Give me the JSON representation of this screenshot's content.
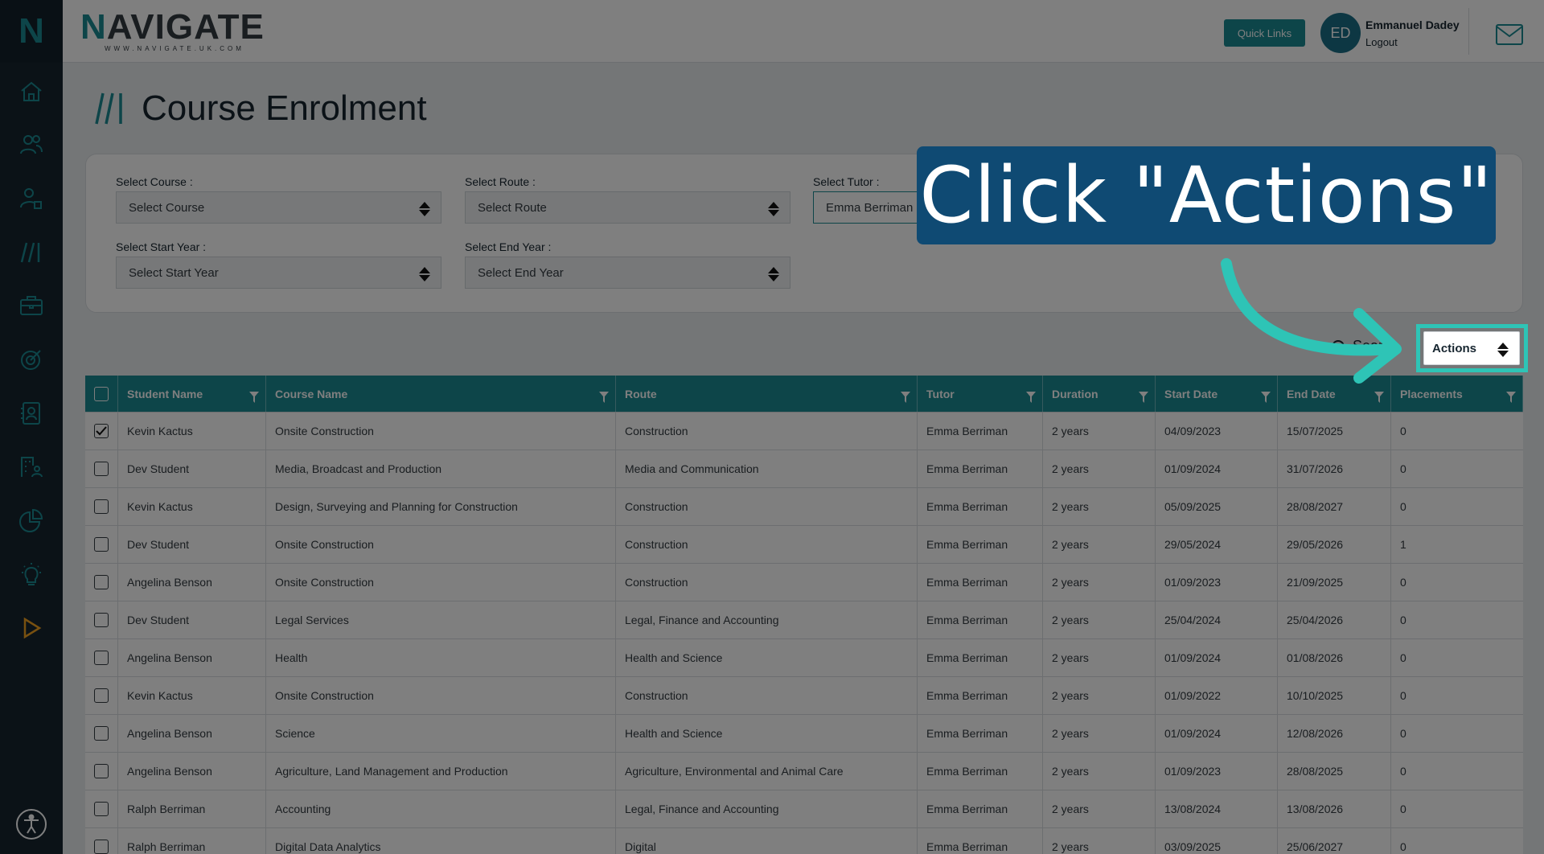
{
  "brand": {
    "name_first": "N",
    "name_rest": "AVIGATE",
    "url": "WWW.NAVIGATE.UK.COM"
  },
  "sidebar": {
    "logo": "N",
    "icons": [
      "home-icon",
      "users-icon",
      "user-tag-icon",
      "courses-icon",
      "briefcase-icon",
      "target-icon",
      "contact-card-icon",
      "building-users-icon",
      "chart-pie-icon",
      "lightbulb-icon",
      "play-icon",
      "accessibility-icon"
    ]
  },
  "header": {
    "quick_links": "Quick Links",
    "avatar_initials": "ED",
    "user_name": "Emmanuel Dadey",
    "logout": "Logout"
  },
  "page": {
    "title": "Course Enrolment"
  },
  "filters": {
    "course_label": "Select Course :",
    "course_value": "Select Course",
    "route_label": "Select Route :",
    "route_value": "Select Route",
    "tutor_label": "Select Tutor :",
    "tutor_value": "Emma Berriman",
    "start_year_label": "Select Start Year :",
    "start_year_value": "Select Start Year",
    "end_year_label": "Select End Year :",
    "end_year_value": "Select End Year"
  },
  "toolbar": {
    "search_label": "Search",
    "actions_label": "Actions"
  },
  "table": {
    "headers": [
      "Student Name",
      "Course Name",
      "Route",
      "Tutor",
      "Duration",
      "Start Date",
      "End Date",
      "Placements"
    ],
    "rows": [
      {
        "checked": true,
        "cells": [
          "Kevin Kactus",
          "Onsite Construction",
          "Construction",
          "Emma Berriman",
          "2 years",
          "04/09/2023",
          "15/07/2025",
          "0"
        ]
      },
      {
        "checked": false,
        "cells": [
          "Dev Student",
          "Media, Broadcast and Production",
          "Media and Communication",
          "Emma Berriman",
          "2 years",
          "01/09/2024",
          "31/07/2026",
          "0"
        ]
      },
      {
        "checked": false,
        "cells": [
          "Kevin Kactus",
          "Design, Surveying and Planning for Construction",
          "Construction",
          "Emma Berriman",
          "2 years",
          "05/09/2025",
          "28/08/2027",
          "0"
        ]
      },
      {
        "checked": false,
        "cells": [
          "Dev Student",
          "Onsite Construction",
          "Construction",
          "Emma Berriman",
          "2 years",
          "29/05/2024",
          "29/05/2026",
          "1"
        ]
      },
      {
        "checked": false,
        "cells": [
          "Angelina Benson",
          "Onsite Construction",
          "Construction",
          "Emma Berriman",
          "2 years",
          "01/09/2023",
          "21/09/2025",
          "0"
        ]
      },
      {
        "checked": false,
        "cells": [
          "Dev Student",
          "Legal Services",
          "Legal, Finance and Accounting",
          "Emma Berriman",
          "2 years",
          "25/04/2024",
          "25/04/2026",
          "0"
        ]
      },
      {
        "checked": false,
        "cells": [
          "Angelina Benson",
          "Health",
          "Health and Science",
          "Emma Berriman",
          "2 years",
          "01/09/2024",
          "01/08/2026",
          "0"
        ]
      },
      {
        "checked": false,
        "cells": [
          "Kevin Kactus",
          "Onsite Construction",
          "Construction",
          "Emma Berriman",
          "2 years",
          "01/09/2022",
          "10/10/2025",
          "0"
        ]
      },
      {
        "checked": false,
        "cells": [
          "Angelina Benson",
          "Science",
          "Health and Science",
          "Emma Berriman",
          "2 years",
          "01/09/2024",
          "12/08/2026",
          "0"
        ]
      },
      {
        "checked": false,
        "cells": [
          "Angelina Benson",
          "Agriculture, Land Management and Production",
          "Agriculture, Environmental and Animal Care",
          "Emma Berriman",
          "2 years",
          "01/09/2023",
          "28/08/2025",
          "0"
        ]
      },
      {
        "checked": false,
        "cells": [
          "Ralph Berriman",
          "Accounting",
          "Legal, Finance and Accounting",
          "Emma Berriman",
          "2 years",
          "13/08/2024",
          "13/08/2026",
          "0"
        ]
      },
      {
        "checked": false,
        "cells": [
          "Ralph Berriman",
          "Digital Data Analytics",
          "Digital",
          "Emma Berriman",
          "2 years",
          "03/09/2025",
          "25/06/2027",
          "0"
        ]
      }
    ]
  },
  "tutorial": {
    "callout": "Click \"Actions\""
  },
  "colors": {
    "teal": "#1b8a93",
    "sidebar": "#16252f",
    "callout_bg": "#0f4a73",
    "highlight": "#2ec4b6"
  }
}
